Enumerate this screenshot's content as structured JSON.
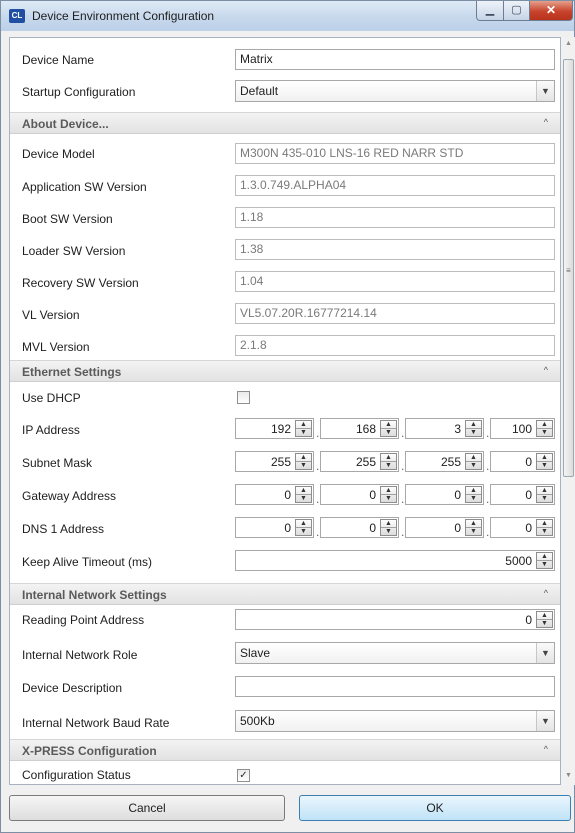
{
  "window": {
    "title": "Device Environment Configuration",
    "logo": "CL",
    "close_glyph": "✕"
  },
  "general": {
    "device_name_label": "Device Name",
    "device_name_value": "Matrix",
    "startup_label": "Startup Configuration",
    "startup_value": "Default"
  },
  "about": {
    "title": "About Device...",
    "fields": [
      {
        "label": "Device Model",
        "value": "M300N 435-010 LNS-16 RED NARR STD"
      },
      {
        "label": "Application SW Version",
        "value": "1.3.0.749.ALPHA04"
      },
      {
        "label": "Boot SW Version",
        "value": "1.18"
      },
      {
        "label": "Loader SW Version",
        "value": "1.38"
      },
      {
        "label": "Recovery SW Version",
        "value": "1.04"
      },
      {
        "label": "VL Version",
        "value": "VL5.07.20R.16777214.14"
      },
      {
        "label": "MVL Version",
        "value": "2.1.8"
      }
    ]
  },
  "ethernet": {
    "title": "Ethernet Settings",
    "use_dhcp_label": "Use DHCP",
    "use_dhcp_checked": false,
    "ip_label": "IP Address",
    "ip": [
      "192",
      "168",
      "3",
      "100"
    ],
    "subnet_label": "Subnet Mask",
    "subnet": [
      "255",
      "255",
      "255",
      "0"
    ],
    "gateway_label": "Gateway Address",
    "gateway": [
      "0",
      "0",
      "0",
      "0"
    ],
    "dns_label": "DNS 1 Address",
    "dns": [
      "0",
      "0",
      "0",
      "0"
    ],
    "keepalive_label": "Keep Alive Timeout (ms)",
    "keepalive_value": "5000"
  },
  "internal": {
    "title": "Internal Network Settings",
    "reading_point_label": "Reading Point Address",
    "reading_point_value": "0",
    "role_label": "Internal Network Role",
    "role_value": "Slave",
    "description_label": "Device Description",
    "description_value": "",
    "baud_label": "Internal Network Baud Rate",
    "baud_value": "500Kb"
  },
  "xpress": {
    "title": "X-PRESS Configuration",
    "status_label": "Configuration Status",
    "status_checked": true
  },
  "buttons": {
    "cancel": "Cancel",
    "ok": "OK"
  },
  "glyphs": {
    "check": "✓",
    "dropdown": "▼",
    "collapse": "^",
    "spin_up": "▲",
    "spin_down": "▼",
    "grip": "≡"
  },
  "icons": [
    "app-logo-icon",
    "minimize-icon",
    "maximize-icon",
    "close-icon",
    "dropdown-arrow-icon",
    "collapse-caret-icon",
    "spin-up-icon",
    "spin-down-icon"
  ]
}
